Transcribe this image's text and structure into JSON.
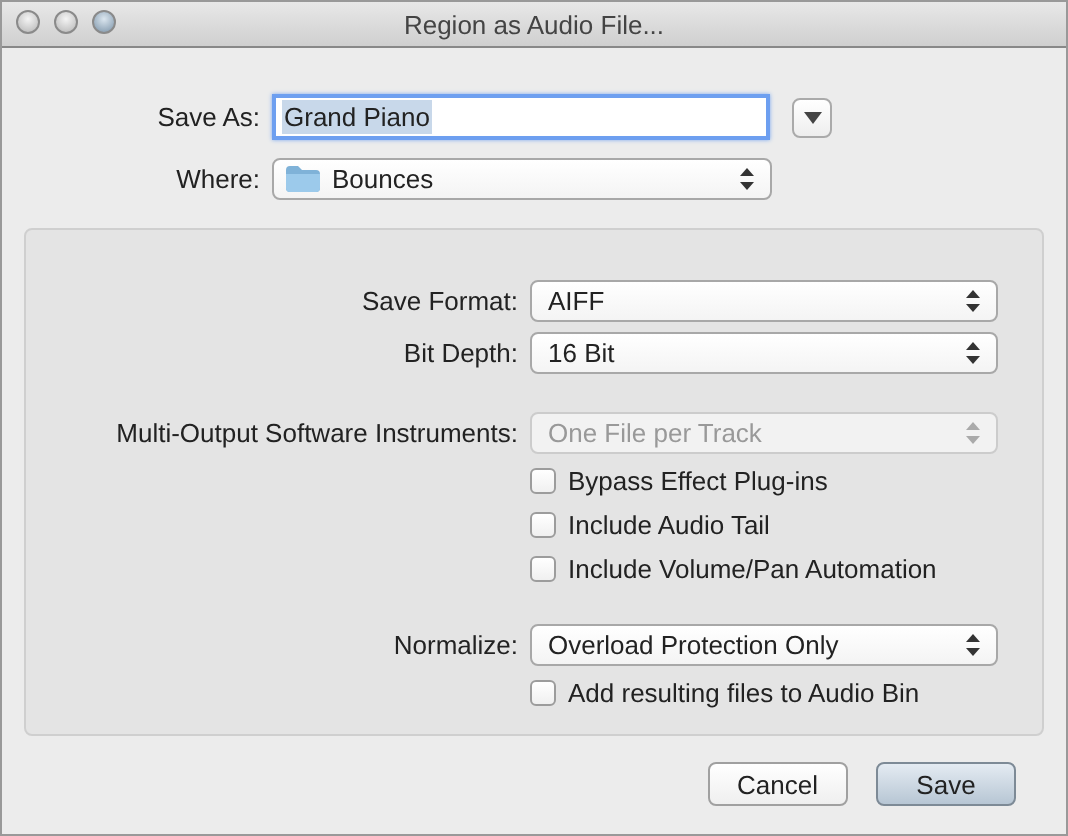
{
  "window": {
    "title": "Region as Audio File..."
  },
  "save_as": {
    "label": "Save As:",
    "value": "Grand Piano",
    "selected": true
  },
  "where": {
    "label": "Where:",
    "value": "Bounces"
  },
  "options": [
    {
      "kind": "popup",
      "label": "Save Format:",
      "value": "AIFF",
      "disabled": false
    },
    {
      "kind": "popup",
      "label": "Bit Depth:",
      "value": "16 Bit",
      "disabled": false
    },
    {
      "kind": "popup",
      "label": "Multi-Output Software Instruments:",
      "value": "One File per Track",
      "disabled": true
    },
    {
      "kind": "checkbox",
      "label": "Bypass Effect Plug-ins",
      "checked": false
    },
    {
      "kind": "checkbox",
      "label": "Include Audio Tail",
      "checked": false
    },
    {
      "kind": "checkbox",
      "label": "Include Volume/Pan Automation",
      "checked": false
    },
    {
      "kind": "popup",
      "label": "Normalize:",
      "value": "Overload Protection Only",
      "disabled": false
    },
    {
      "kind": "checkbox",
      "label": "Add resulting files to Audio Bin",
      "checked": false
    }
  ],
  "buttons": [
    {
      "label": "Cancel",
      "default": false
    },
    {
      "label": "Save",
      "default": true
    }
  ]
}
